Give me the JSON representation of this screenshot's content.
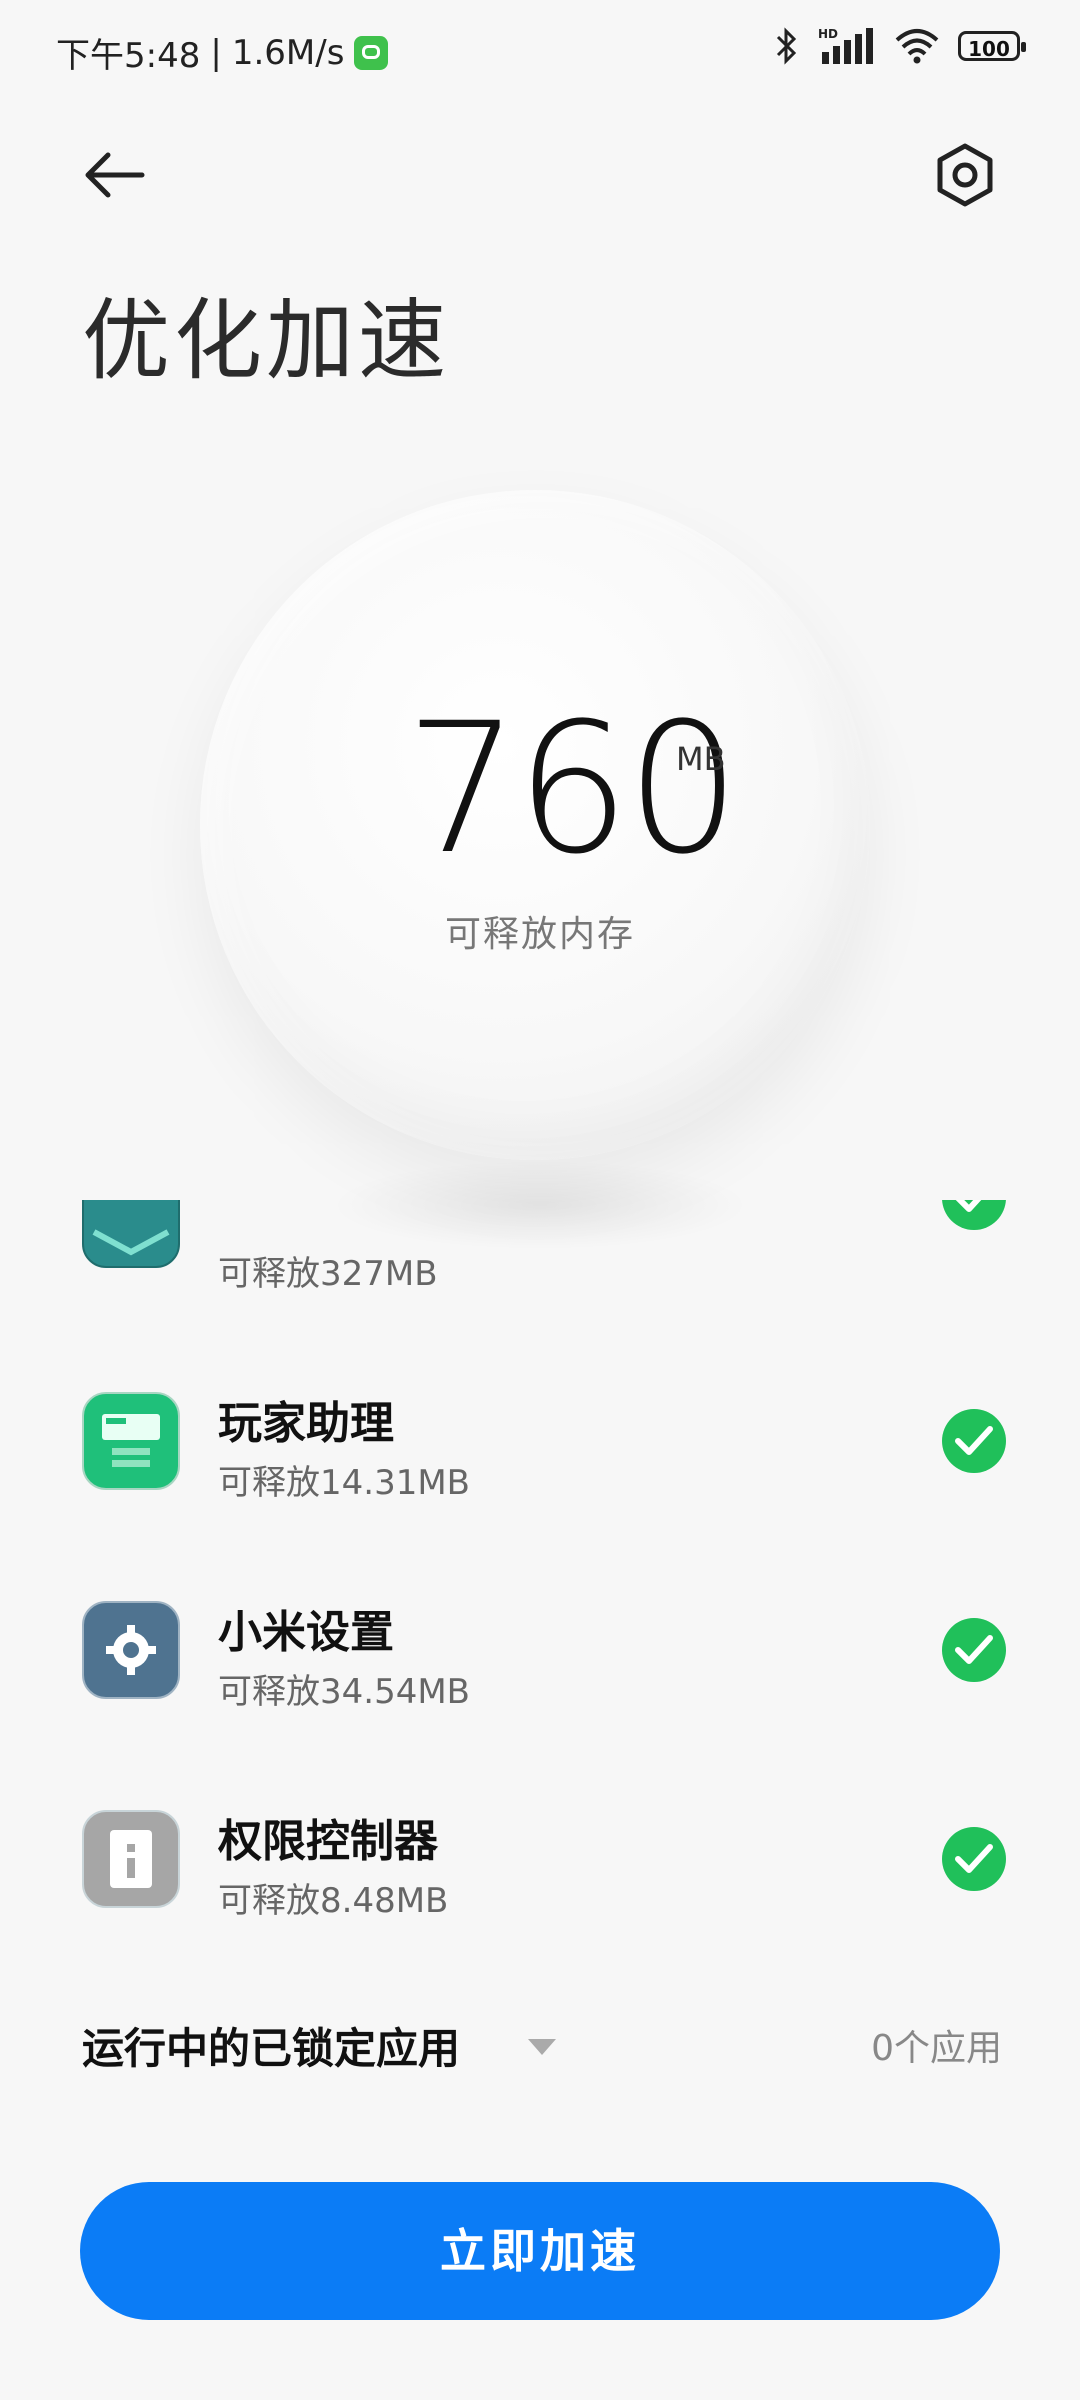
{
  "status_bar": {
    "time": "下午5:48",
    "speed": "1.6M/s",
    "battery": "100",
    "icons": [
      "bluetooth-icon",
      "hd-signal-icon",
      "wifi-icon",
      "battery-icon"
    ]
  },
  "header": {
    "back_icon": "arrow-left-icon",
    "settings_icon": "settings-hex-icon",
    "title": "优化加速"
  },
  "memory": {
    "value": "760",
    "unit": "MB",
    "label": "可释放内存"
  },
  "apps": [
    {
      "name": "",
      "sub": "可释放327MB",
      "icon": "partial-app-icon",
      "checked": true
    },
    {
      "name": "玩家助理",
      "sub": "可释放14.31MB",
      "icon": "game-assistant-icon",
      "checked": true
    },
    {
      "name": "小米设置",
      "sub": "可释放34.54MB",
      "icon": "xiaomi-settings-icon",
      "checked": true
    },
    {
      "name": "权限控制器",
      "sub": "可释放8.48MB",
      "icon": "permission-controller-icon",
      "checked": true
    }
  ],
  "locked": {
    "title": "运行中的已锁定应用",
    "count": "0个应用"
  },
  "action": {
    "button_label": "立即加速"
  },
  "colors": {
    "accent": "#0b7cf6",
    "check": "#20c05a"
  }
}
